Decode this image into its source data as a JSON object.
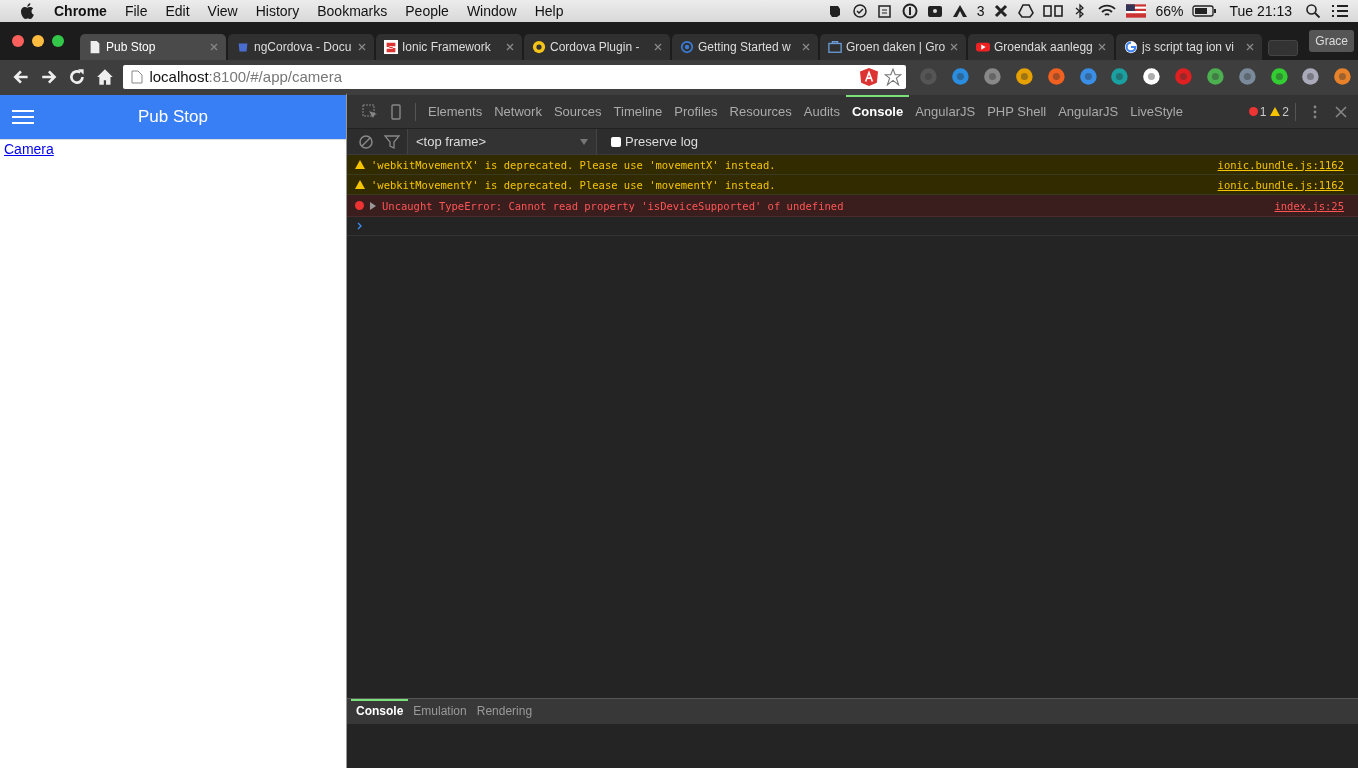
{
  "menu_bar": {
    "app": "Chrome",
    "menus": [
      "File",
      "Edit",
      "View",
      "History",
      "Bookmarks",
      "People",
      "Window",
      "Help"
    ],
    "status": {
      "badge_count": "3",
      "battery": "66%",
      "clock": "Tue 21:13"
    }
  },
  "tabs": [
    {
      "title": "Pub Stop",
      "kind": "page",
      "selected": true
    },
    {
      "title": "ngCordova - Docu",
      "kind": "cordova",
      "selected": false
    },
    {
      "title": "Ionic Framework",
      "kind": "ionic",
      "selected": false
    },
    {
      "title": "Cordova Plugin -",
      "kind": "plugin",
      "selected": false
    },
    {
      "title": "Getting Started w",
      "kind": "ring",
      "selected": false
    },
    {
      "title": "Groen daken | Gro",
      "kind": "folder",
      "selected": false
    },
    {
      "title": "Groendak aanlegg",
      "kind": "video",
      "selected": false
    },
    {
      "title": "js script tag ion vi",
      "kind": "google",
      "selected": false
    }
  ],
  "profile": "Grace",
  "address": {
    "host": "localhost",
    "rest": ":8100/#/app/camera"
  },
  "page": {
    "title": "Pub Stop",
    "link": "Camera"
  },
  "devtools": {
    "tabs": [
      {
        "label": "Elements",
        "selected": false
      },
      {
        "label": "Network",
        "selected": false
      },
      {
        "label": "Sources",
        "selected": false
      },
      {
        "label": "Timeline",
        "selected": false
      },
      {
        "label": "Profiles",
        "selected": false
      },
      {
        "label": "Resources",
        "selected": false
      },
      {
        "label": "Audits",
        "selected": false
      },
      {
        "label": "Console",
        "selected": true
      },
      {
        "label": "AngularJS",
        "selected": false
      },
      {
        "label": "PHP Shell",
        "selected": false
      },
      {
        "label": "AngularJS",
        "selected": false
      },
      {
        "label": "LiveStyle",
        "selected": false
      }
    ],
    "error_count": "1",
    "warning_count": "2",
    "frame": "<top frame>",
    "preserve_log": {
      "label": "Preserve log",
      "checked": false
    },
    "messages": [
      {
        "kind": "warning",
        "text": "'webkitMovementX' is deprecated. Please use 'movementX' instead.",
        "source": "ionic.bundle.js:1162"
      },
      {
        "kind": "warning",
        "text": "'webkitMovementY' is deprecated. Please use 'movementY' instead.",
        "source": "ionic.bundle.js:1162"
      },
      {
        "kind": "error",
        "text": "Uncaught TypeError: Cannot read property 'isDeviceSupported' of undefined",
        "source": "index.js:25"
      }
    ],
    "drawer_tabs": [
      {
        "label": "Console",
        "selected": true
      },
      {
        "label": "Emulation",
        "selected": false
      },
      {
        "label": "Rendering",
        "selected": false
      }
    ]
  }
}
